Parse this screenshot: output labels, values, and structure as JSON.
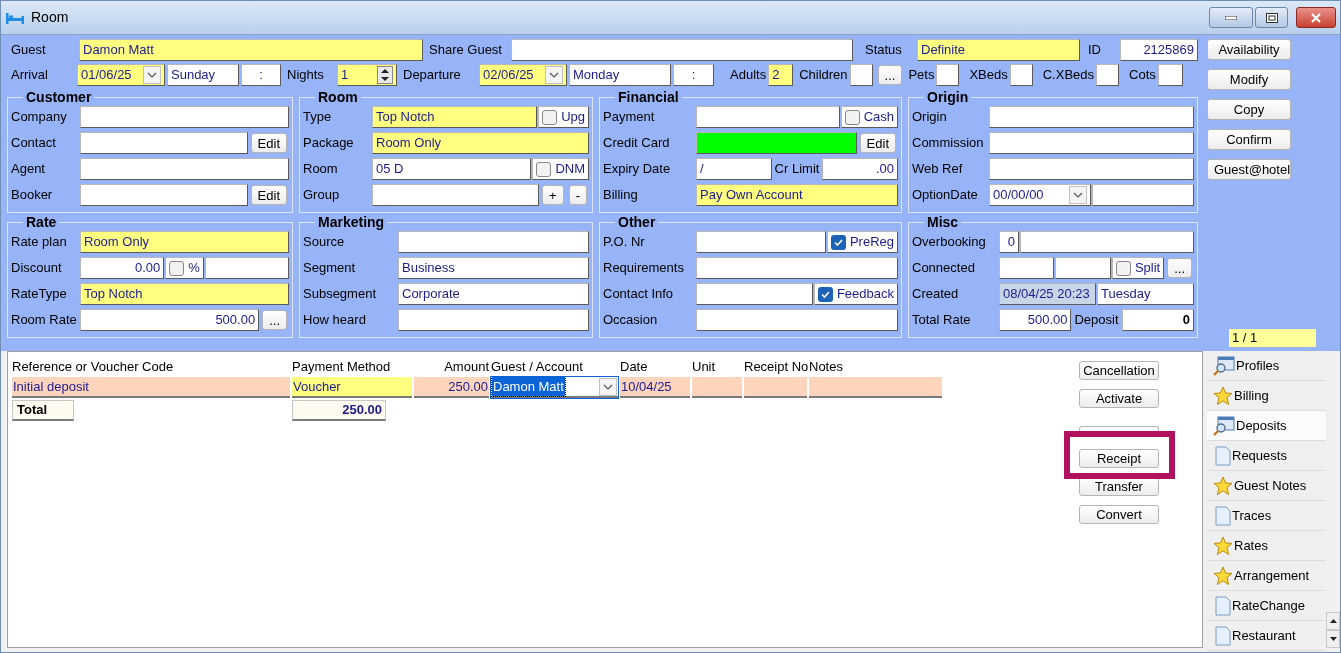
{
  "window": {
    "title": "Room"
  },
  "header": {
    "guest": {
      "label": "Guest",
      "value": "Damon Matt",
      "color": "#ffff80"
    },
    "share_guest": {
      "label": "Share Guest",
      "color": "#ffffff"
    },
    "status": {
      "label": "Status",
      "value": "Definite",
      "color": "#ffff80"
    },
    "id": {
      "label": "ID",
      "value": "2125869",
      "color": "#ffffff"
    },
    "arrival": {
      "label": "Arrival",
      "value": "01/06/25",
      "day": "Sunday",
      "time": ":",
      "color": "#ffff80"
    },
    "nights": {
      "label": "Nights",
      "value": "1",
      "color": "#ffff80"
    },
    "departure": {
      "label": "Departure",
      "value": "02/06/25",
      "day": "Monday",
      "time": ":",
      "color": "#ffff80"
    },
    "adults": {
      "label": "Adults",
      "value": "2",
      "color": "#ffff80"
    },
    "children": {
      "label": "Children",
      "button": "...",
      "color": "#ffffff"
    },
    "pets": {
      "label": "Pets",
      "color": "#ffffff"
    },
    "xbeds": {
      "label": "XBeds",
      "color": "#ffffff"
    },
    "cxbeds": {
      "label": "C.XBeds",
      "color": "#ffffff"
    },
    "cots": {
      "label": "Cots",
      "color": "#ffffff"
    }
  },
  "side_buttons": [
    "Availability",
    "Modify",
    "Copy",
    "Confirm",
    "Guest@hotel"
  ],
  "page_counter": "1 / 1",
  "groups": [
    {
      "title": "Customer",
      "rows": [
        {
          "label": "Company",
          "parts": [
            {
              "kind": "field",
              "color": "#ffffff"
            }
          ]
        },
        {
          "label": "Contact",
          "parts": [
            {
              "kind": "field",
              "color": "#ffffff"
            },
            {
              "kind": "button",
              "text": "Edit"
            }
          ]
        },
        {
          "label": "Agent",
          "parts": [
            {
              "kind": "field",
              "color": "#ffffff"
            }
          ]
        },
        {
          "label": "Booker",
          "parts": [
            {
              "kind": "field",
              "color": "#ffffff"
            },
            {
              "kind": "button",
              "text": "Edit"
            }
          ]
        }
      ]
    },
    {
      "title": "Room",
      "rows": [
        {
          "label": "Type",
          "parts": [
            {
              "kind": "field",
              "value": "Top Notch",
              "color": "#ffff80"
            },
            {
              "kind": "check",
              "text": "Upg",
              "checked": false
            }
          ]
        },
        {
          "label": "Package",
          "parts": [
            {
              "kind": "field",
              "value": "Room Only",
              "color": "#ffff80"
            }
          ]
        },
        {
          "label": "Room",
          "parts": [
            {
              "kind": "field",
              "value": "05 D",
              "color": "#ffffff"
            },
            {
              "kind": "check",
              "text": "DNM",
              "checked": false
            }
          ]
        },
        {
          "label": "Group",
          "parts": [
            {
              "kind": "field",
              "color": "#ffffff"
            },
            {
              "kind": "button",
              "text": "+"
            },
            {
              "kind": "button",
              "text": "-"
            }
          ]
        }
      ]
    },
    {
      "title": "Financial",
      "rows": [
        {
          "label": "Payment",
          "parts": [
            {
              "kind": "field",
              "color": "#ffffff"
            },
            {
              "kind": "check",
              "text": "Cash",
              "checked": false
            }
          ]
        },
        {
          "label": "Credit Card",
          "parts": [
            {
              "kind": "field",
              "color": "#00ff00"
            },
            {
              "kind": "button",
              "text": "Edit"
            }
          ]
        },
        {
          "label": "Expiry Date",
          "parts": [
            {
              "kind": "field",
              "value": "/",
              "color": "#ffffff"
            },
            {
              "kind": "label",
              "text": "Cr Limit"
            },
            {
              "kind": "number",
              "value": ".00",
              "color": "#ffffff"
            }
          ]
        },
        {
          "label": "Billing",
          "parts": [
            {
              "kind": "field",
              "value": "Pay Own Account",
              "color": "#ffff80"
            }
          ]
        }
      ]
    },
    {
      "title": "Origin",
      "rows": [
        {
          "label": "Origin",
          "parts": [
            {
              "kind": "field",
              "color": "#ffffff"
            }
          ]
        },
        {
          "label": "Commission",
          "parts": [
            {
              "kind": "field",
              "color": "#ffffff"
            }
          ]
        },
        {
          "label": "Web Ref",
          "parts": [
            {
              "kind": "field",
              "color": "#ffffff"
            }
          ]
        },
        {
          "label": "OptionDate",
          "parts": [
            {
              "kind": "date",
              "value": "00/00/00",
              "color": "#ffffff"
            },
            {
              "kind": "field",
              "color": "#ffffff"
            }
          ]
        }
      ]
    },
    {
      "title": "Rate",
      "rows": [
        {
          "label": "Rate plan",
          "parts": [
            {
              "kind": "field",
              "value": "Room Only",
              "color": "#ffff80"
            }
          ]
        },
        {
          "label": "Discount",
          "parts": [
            {
              "kind": "number",
              "value": "0.00",
              "color": "#ffffff"
            },
            {
              "kind": "check",
              "text": "%",
              "checked": false
            },
            {
              "kind": "field",
              "color": "#ffffff"
            }
          ]
        },
        {
          "label": "RateType",
          "parts": [
            {
              "kind": "field",
              "value": "Top Notch",
              "color": "#ffff80"
            }
          ]
        },
        {
          "label": "Room Rate",
          "parts": [
            {
              "kind": "number",
              "value": "500.00",
              "color": "#ffffff"
            },
            {
              "kind": "button",
              "text": "..."
            }
          ]
        }
      ]
    },
    {
      "title": "Marketing",
      "rows": [
        {
          "label": "Source",
          "parts": [
            {
              "kind": "field",
              "color": "#ffffff"
            }
          ]
        },
        {
          "label": "Segment",
          "parts": [
            {
              "kind": "field",
              "value": "Business",
              "color": "#ffffff"
            }
          ]
        },
        {
          "label": "Subsegment",
          "parts": [
            {
              "kind": "field",
              "value": "Corporate",
              "color": "#ffffff"
            }
          ]
        },
        {
          "label": "How heard",
          "parts": [
            {
              "kind": "field",
              "color": "#ffffff"
            }
          ]
        }
      ]
    },
    {
      "title": "Other",
      "rows": [
        {
          "label": "P.O. Nr",
          "parts": [
            {
              "kind": "field",
              "color": "#ffffff"
            },
            {
              "kind": "check",
              "text": "PreReg",
              "checked": true
            }
          ]
        },
        {
          "label": "Requirements",
          "parts": [
            {
              "kind": "field",
              "color": "#ffffff"
            }
          ]
        },
        {
          "label": "Contact Info",
          "parts": [
            {
              "kind": "field",
              "color": "#ffffff"
            },
            {
              "kind": "check",
              "text": "Feedback",
              "checked": true
            }
          ]
        },
        {
          "label": "Occasion",
          "parts": [
            {
              "kind": "field",
              "color": "#ffffff"
            }
          ]
        }
      ]
    },
    {
      "title": "Misc",
      "rows": [
        {
          "label": "Overbooking",
          "parts": [
            {
              "kind": "count",
              "value": "0",
              "color": "#ffffff"
            },
            {
              "kind": "field",
              "color": "#ffffff"
            }
          ]
        },
        {
          "label": "Connected",
          "parts": [
            {
              "kind": "field",
              "color": "#ffffff"
            },
            {
              "kind": "field",
              "color": "#ffffff"
            },
            {
              "kind": "check",
              "text": "Split",
              "checked": false
            },
            {
              "kind": "button",
              "text": "..."
            }
          ]
        },
        {
          "label": "Created",
          "parts": [
            {
              "kind": "field",
              "value": "08/04/25 20:23",
              "color": "#c6d6e6"
            },
            {
              "kind": "field",
              "value": "Tuesday",
              "color": "#ffffff"
            }
          ]
        },
        {
          "label": "Total Rate",
          "parts": [
            {
              "kind": "number",
              "value": "500.00",
              "color": "#ffffff"
            },
            {
              "kind": "label",
              "text": "Deposit"
            },
            {
              "kind": "total",
              "value": "0",
              "color": "#ffffff"
            }
          ]
        }
      ]
    }
  ],
  "deposits": {
    "columns": [
      "Reference or Voucher Code",
      "Payment Method",
      "Amount",
      "Guest / Account",
      "Date",
      "Unit",
      "Receipt No",
      "Notes"
    ],
    "rows": [
      {
        "cells": [
          {
            "kind": "text",
            "value": "Initial deposit",
            "color": "#ffd4bd",
            "selected": false
          },
          {
            "kind": "text",
            "value": "Voucher",
            "color": "#ffff80",
            "selected": false
          },
          {
            "kind": "number",
            "value": "250.00",
            "color": "#ffd4bd",
            "selected": false
          },
          {
            "kind": "dropdown",
            "value": "Damon Matt",
            "color": "#ffffff",
            "selected": true
          },
          {
            "kind": "text",
            "value": "10/04/25",
            "color": "#ffd4bd",
            "selected": false
          },
          {
            "kind": "text",
            "color": "#ffd4bd",
            "selected": false
          },
          {
            "kind": "text",
            "color": "#ffd4bd",
            "selected": false
          },
          {
            "kind": "text",
            "color": "#ffd4bd",
            "selected": false
          }
        ]
      }
    ],
    "total": {
      "label": "Total",
      "amount": "250.00"
    }
  },
  "actions": [
    {
      "label": "Cancellation",
      "highlighted": false
    },
    {
      "label": "Activate",
      "highlighted": false
    },
    {
      "highlighted": false
    },
    {
      "label": "Receipt",
      "highlighted": true
    },
    {
      "label": "Transfer",
      "highlighted": false
    },
    {
      "label": "Convert",
      "highlighted": false
    }
  ],
  "tabs": [
    {
      "label": "Profiles",
      "kind": "search",
      "selected": false
    },
    {
      "label": "Billing",
      "kind": "star",
      "selected": false
    },
    {
      "label": "Deposits",
      "kind": "search",
      "selected": true
    },
    {
      "label": "Requests",
      "kind": "page",
      "selected": false
    },
    {
      "label": "Guest Notes",
      "kind": "star",
      "selected": false
    },
    {
      "label": "Traces",
      "kind": "page",
      "selected": false
    },
    {
      "label": "Rates",
      "kind": "star",
      "selected": false
    },
    {
      "label": "Arrangement",
      "kind": "star",
      "selected": false
    },
    {
      "label": "RateChange",
      "kind": "page",
      "selected": false
    },
    {
      "label": "Restaurant",
      "kind": "page",
      "selected": false
    }
  ]
}
